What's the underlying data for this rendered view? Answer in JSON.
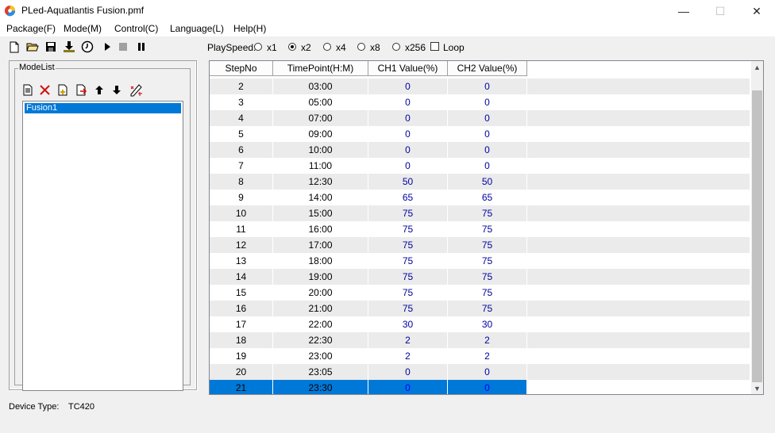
{
  "window": {
    "title": "PLed-Aquatlantis Fusion.pmf",
    "minimize": "—",
    "maximize": "☐",
    "close": "✕"
  },
  "menu": [
    {
      "label": "Package(F)"
    },
    {
      "label": "Mode(M)"
    },
    {
      "label": "Control(C)"
    },
    {
      "label": "Language(L)"
    },
    {
      "label": "Help(H)"
    }
  ],
  "toolbar": {
    "icons": [
      "new-file-icon",
      "open-folder-icon",
      "save-disk-icon",
      "download-icon",
      "clock-icon",
      "play-icon",
      "stop-icon",
      "pause-icon"
    ]
  },
  "playspeed": {
    "label": "PlaySpeed:",
    "options": [
      "x1",
      "x2",
      "x4",
      "x8",
      "x256"
    ],
    "selected": "x2",
    "loop_label": "Loop",
    "loop_checked": false
  },
  "modelist": {
    "label": "ModeList",
    "icons": [
      "new-mode-icon",
      "delete-mode-icon",
      "add-mode-icon",
      "export-mode-icon",
      "move-up-icon",
      "move-down-icon",
      "edit-mode-icon"
    ],
    "items": [
      "Fusion1"
    ],
    "selected": "Fusion1"
  },
  "grid": {
    "columns": [
      "StepNo",
      "TimePoint(H:M)",
      "CH1 Value(%)",
      "CH2 Value(%)"
    ],
    "rows": [
      [
        "2",
        "03:00",
        "0",
        "0"
      ],
      [
        "3",
        "05:00",
        "0",
        "0"
      ],
      [
        "4",
        "07:00",
        "0",
        "0"
      ],
      [
        "5",
        "09:00",
        "0",
        "0"
      ],
      [
        "6",
        "10:00",
        "0",
        "0"
      ],
      [
        "7",
        "11:00",
        "0",
        "0"
      ],
      [
        "8",
        "12:30",
        "50",
        "50"
      ],
      [
        "9",
        "14:00",
        "65",
        "65"
      ],
      [
        "10",
        "15:00",
        "75",
        "75"
      ],
      [
        "11",
        "16:00",
        "75",
        "75"
      ],
      [
        "12",
        "17:00",
        "75",
        "75"
      ],
      [
        "13",
        "18:00",
        "75",
        "75"
      ],
      [
        "14",
        "19:00",
        "75",
        "75"
      ],
      [
        "15",
        "20:00",
        "75",
        "75"
      ],
      [
        "16",
        "21:00",
        "75",
        "75"
      ],
      [
        "17",
        "22:00",
        "30",
        "30"
      ],
      [
        "18",
        "22:30",
        "2",
        "2"
      ],
      [
        "19",
        "23:00",
        "2",
        "2"
      ],
      [
        "20",
        "23:05",
        "0",
        "0"
      ],
      [
        "21",
        "23:30",
        "0",
        "0"
      ]
    ],
    "selected_step": "21"
  },
  "status": {
    "device_type_label": "Device Type:",
    "device_type_value": "TC420"
  },
  "colors": {
    "accent": "#0078d7",
    "value_text": "#0000a0"
  }
}
